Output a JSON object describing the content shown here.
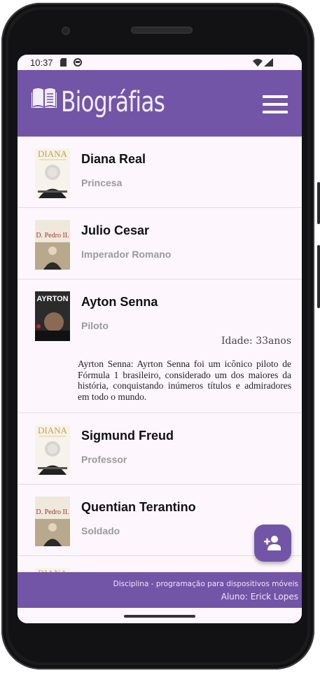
{
  "status": {
    "time": "10:37"
  },
  "app": {
    "title": "Biográfias"
  },
  "items": [
    {
      "name": "Diana Real",
      "role": "Princesa",
      "cover": "diana"
    },
    {
      "name": "Julio Cesar",
      "role": "Imperador Romano",
      "cover": "pedro"
    },
    {
      "name": "Ayton Senna",
      "role": "Piloto",
      "cover": "ayrton",
      "age": "Idade: 33anos",
      "description": "Ayrton Senna: Ayrton Senna foi um icônico piloto de Fórmula 1 brasileiro, considerado um dos maiores da história, conquistando inúmeros títulos e admiradores em todo o mundo."
    },
    {
      "name": "Sigmund Freud",
      "role": "Professor",
      "cover": "diana"
    },
    {
      "name": "Quentian Terantino",
      "role": "Soldado",
      "cover": "pedro"
    }
  ],
  "covers": {
    "diana": "DIANA",
    "pedro": "D. Pedro II.",
    "ayrton": "AYRTON"
  },
  "footer": {
    "line1": "Disciplina - programação para dispositivos móveis",
    "line2": "Aluno: Erick Lopes"
  },
  "colors": {
    "primary": "#7355a7",
    "background": "#fdf7fd"
  },
  "icons": {
    "logo": "book-open-icon",
    "menu": "hamburger-menu-icon",
    "fab": "person-add-icon"
  }
}
